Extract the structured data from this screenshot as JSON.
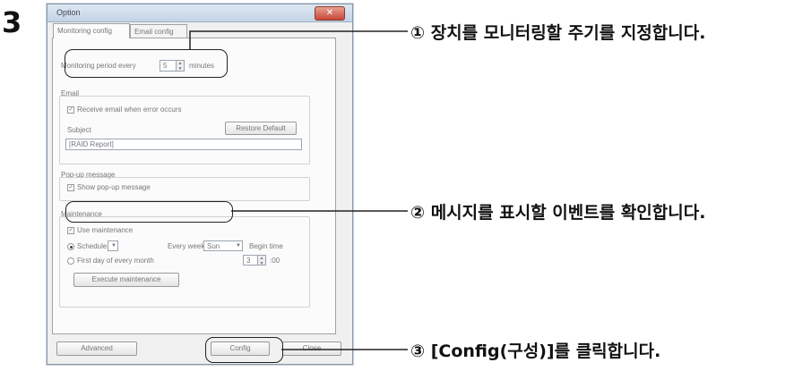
{
  "step_number": "3",
  "dialog": {
    "title": "Option",
    "close_icon": "close-icon",
    "tabs": [
      "Monitoring config",
      "Email config"
    ],
    "monitoring_label": "Monitoring period every",
    "monitoring_value": "5",
    "monitoring_unit": "minutes",
    "email": {
      "group_label": "Email",
      "checkbox_label": "Receive email when error occurs",
      "subject_label": "Subject",
      "restore_button": "Restore Default",
      "subject_value": "[RAID Report]"
    },
    "popup": {
      "group_label": "Pop-up message",
      "checkbox_label": "Show pop-up message"
    },
    "maintenance": {
      "group_label": "Maintenance",
      "checkbox_label": "Use maintenance",
      "schedule_label": "Schedule",
      "every_week_label": "Every week",
      "day_value": "Sun",
      "begin_time_label": "Begin time",
      "first_day_label": "First day of every month",
      "time_value": "3",
      "time_unit": ":00",
      "execute_button": "Execute maintenance"
    },
    "bottom_buttons": [
      "Advanced",
      "Config",
      "Close"
    ]
  },
  "annotations": [
    "① 장치를 모니터링할 주기를 지정합니다.",
    "② 메시지를 표시할 이벤트를 확인합니다.",
    "③ [Config(구성)]를 클릭합니다."
  ]
}
